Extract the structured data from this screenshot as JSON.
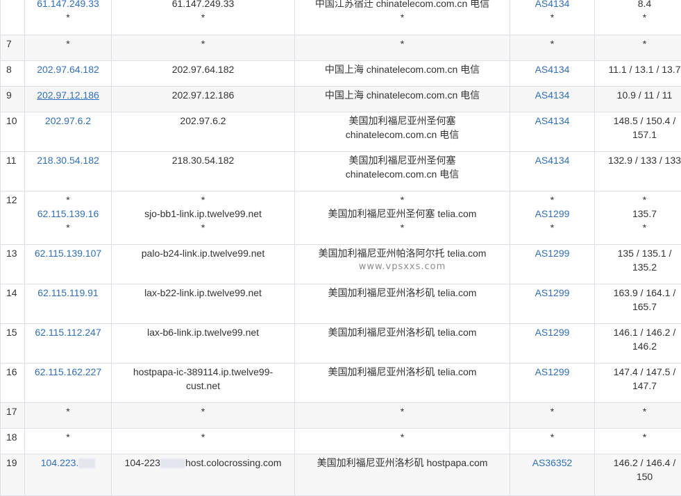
{
  "rows": [
    {
      "hop": "",
      "ip": [
        "61.147.249.33",
        "*"
      ],
      "host": [
        "61.147.249.33",
        "*"
      ],
      "loc": [
        "中国江苏宿迁 chinatelecom.com.cn 电信",
        "*"
      ],
      "asn": [
        "AS4134",
        "*"
      ],
      "rtt": [
        "8.4",
        "*"
      ]
    },
    {
      "hop": "7",
      "ip": [
        "*"
      ],
      "host": [
        "*"
      ],
      "loc": [
        "*"
      ],
      "asn": [
        "*"
      ],
      "rtt": [
        "*"
      ]
    },
    {
      "hop": "8",
      "ip": [
        "202.97.64.182"
      ],
      "host": [
        "202.97.64.182"
      ],
      "loc": [
        "中国上海 chinatelecom.com.cn 电信"
      ],
      "asn": [
        "AS4134"
      ],
      "rtt": [
        "11.1 / 13.1 / 13.7"
      ]
    },
    {
      "hop": "9",
      "ip": [
        "202.97.12.186"
      ],
      "host": [
        "202.97.12.186"
      ],
      "loc": [
        "中国上海 chinatelecom.com.cn 电信"
      ],
      "asn": [
        "AS4134"
      ],
      "rtt": [
        "10.9 / 11 / 11"
      ]
    },
    {
      "hop": "10",
      "ip": [
        "202.97.6.2"
      ],
      "host": [
        "202.97.6.2"
      ],
      "loc": [
        "美国加利福尼亚州圣何塞",
        "chinatelecom.com.cn 电信"
      ],
      "asn": [
        "AS4134"
      ],
      "rtt": [
        "148.5 / 150.4 /",
        "157.1"
      ]
    },
    {
      "hop": "11",
      "ip": [
        "218.30.54.182"
      ],
      "host": [
        "218.30.54.182"
      ],
      "loc": [
        "美国加利福尼亚州圣何塞",
        "chinatelecom.com.cn 电信"
      ],
      "asn": [
        "AS4134"
      ],
      "rtt": [
        "132.9 / 133 / 133"
      ]
    },
    {
      "hop": "12",
      "ip": [
        "*",
        "62.115.139.16",
        "*"
      ],
      "host": [
        "*",
        "sjo-bb1-link.ip.twelve99.net",
        "*"
      ],
      "loc": [
        "*",
        "美国加利福尼亚州圣何塞 telia.com",
        "*"
      ],
      "asn": [
        "*",
        "AS1299",
        "*"
      ],
      "rtt": [
        "*",
        "135.7",
        "*"
      ]
    },
    {
      "hop": "13",
      "ip": [
        "62.115.139.107"
      ],
      "host": [
        "palo-b24-link.ip.twelve99.net"
      ],
      "loc": [
        "美国加利福尼亚州帕洛阿尔托 telia.com"
      ],
      "asn": [
        "AS1299"
      ],
      "rtt": [
        "135 / 135.1 /",
        "135.2"
      ]
    },
    {
      "hop": "14",
      "ip": [
        "62.115.119.91"
      ],
      "host": [
        "lax-b22-link.ip.twelve99.net"
      ],
      "loc": [
        "美国加利福尼亚州洛杉矶 telia.com"
      ],
      "asn": [
        "AS1299"
      ],
      "rtt": [
        "163.9 / 164.1 /",
        "165.7"
      ]
    },
    {
      "hop": "15",
      "ip": [
        "62.115.112.247"
      ],
      "host": [
        "lax-b6-link.ip.twelve99.net"
      ],
      "loc": [
        "美国加利福尼亚州洛杉矶 telia.com"
      ],
      "asn": [
        "AS1299"
      ],
      "rtt": [
        "146.1 / 146.2 /",
        "146.2"
      ]
    },
    {
      "hop": "16",
      "ip": [
        "62.115.162.227"
      ],
      "host": [
        "hostpapa-ic-389114.ip.twelve99-",
        "cust.net"
      ],
      "loc": [
        "美国加利福尼亚州洛杉矶 telia.com"
      ],
      "asn": [
        "AS1299"
      ],
      "rtt": [
        "147.4 / 147.5 /",
        "147.7"
      ]
    },
    {
      "hop": "17",
      "ip": [
        "*"
      ],
      "host": [
        "*"
      ],
      "loc": [
        "*"
      ],
      "asn": [
        "*"
      ],
      "rtt": [
        "*"
      ]
    },
    {
      "hop": "18",
      "ip": [
        "*"
      ],
      "host": [
        "*"
      ],
      "loc": [
        "*"
      ],
      "asn": [
        "*"
      ],
      "rtt": [
        "*"
      ]
    },
    {
      "hop": "19",
      "ip_prefix": "104.223.",
      "host_prefix": "104-223",
      "host_suffix": "host.colocrossing.com",
      "loc": [
        "美国加利福尼亚州洛杉矶 hostpapa.com"
      ],
      "asn": [
        "AS36352"
      ],
      "rtt": [
        "146.2 / 146.4 /",
        "150"
      ]
    }
  ],
  "watermark": "www.vpsxxs.com"
}
